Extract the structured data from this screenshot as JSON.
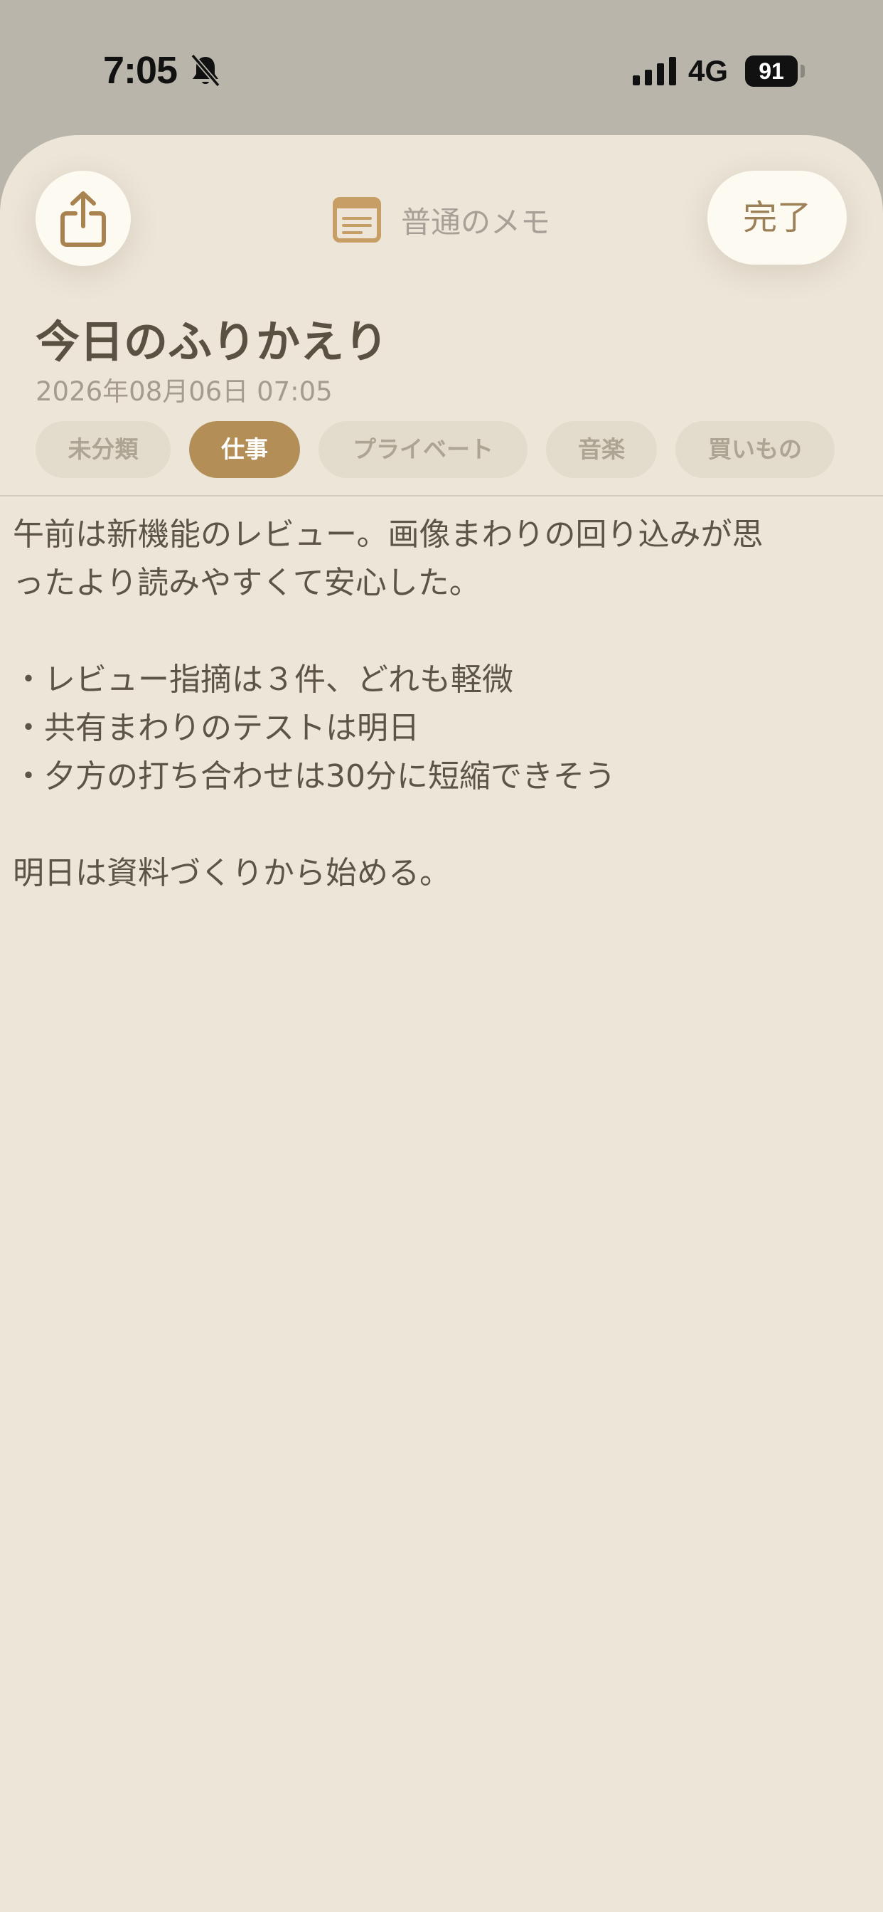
{
  "status_bar": {
    "time": "7:05",
    "network": "4G",
    "battery": "91"
  },
  "toolbar": {
    "share_icon": "share-icon",
    "note_type_icon": "note-icon",
    "note_type_label": "普通のメモ",
    "done_label": "完了"
  },
  "note": {
    "title": "今日のふりかえり",
    "date": "2026年08月06日 07:05",
    "tags": [
      {
        "label": "未分類",
        "active": false
      },
      {
        "label": "仕事",
        "active": true
      },
      {
        "label": "プライベート",
        "active": false
      },
      {
        "label": "音楽",
        "active": false
      },
      {
        "label": "買いもの",
        "active": false
      }
    ],
    "body_lines": [
      "午前は新機能のレビュー。画像まわりの回り込みが思",
      "ったより読みやすくて安心した。",
      "",
      "・レビュー指摘は３件、どれも軽微",
      "・共有まわりのテストは明日",
      "・夕方の打ち合わせは30分に短縮できそう",
      "",
      "明日は資料づくりから始める。"
    ]
  },
  "colors": {
    "accent": "#b38f57",
    "sheet_background": "#ece5d8",
    "text": "#5c5446"
  }
}
